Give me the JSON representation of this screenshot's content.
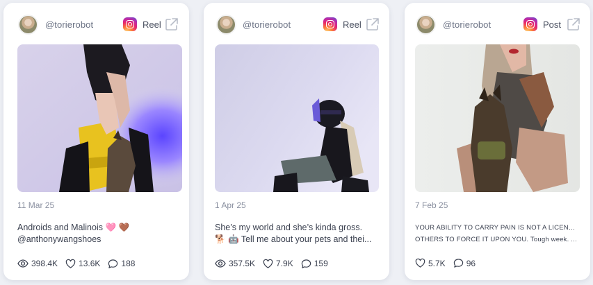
{
  "cards": [
    {
      "handle": "@torierobot",
      "platform_icon": "instagram-icon",
      "type_label": "Reel",
      "date": "11 Mar 25",
      "caption_lines": [
        "Androids and Malinois 🩷 🤎",
        "@anthonywangshoes"
      ],
      "stats": {
        "views": "398.4K",
        "likes": "13.6K",
        "comments": "188"
      }
    },
    {
      "handle": "@torierobot",
      "platform_icon": "instagram-icon",
      "type_label": "Reel",
      "date": "1 Apr 25",
      "caption_lines": [
        "She’s my world and she’s kinda gross.",
        "🐕 🤖 Tell me about your pets and thei..."
      ],
      "stats": {
        "views": "357.5K",
        "likes": "7.9K",
        "comments": "159"
      }
    },
    {
      "handle": "@torierobot",
      "platform_icon": "instagram-icon",
      "type_label": "Post",
      "date": "7 Feb 25",
      "caption_lines": [
        "YOUR ABILITY TO CARRY PAIN IS NOT A LICENSE FOR",
        "OTHERS TO FORCE IT UPON YOU. Tough week. A..."
      ],
      "stats": {
        "views": "",
        "likes": "5.7K",
        "comments": "96"
      }
    }
  ],
  "colors": {
    "page_bg": "#eef0f5",
    "card_bg": "#ffffff",
    "muted_text": "#8a90a0",
    "body_text": "#3b4150"
  }
}
